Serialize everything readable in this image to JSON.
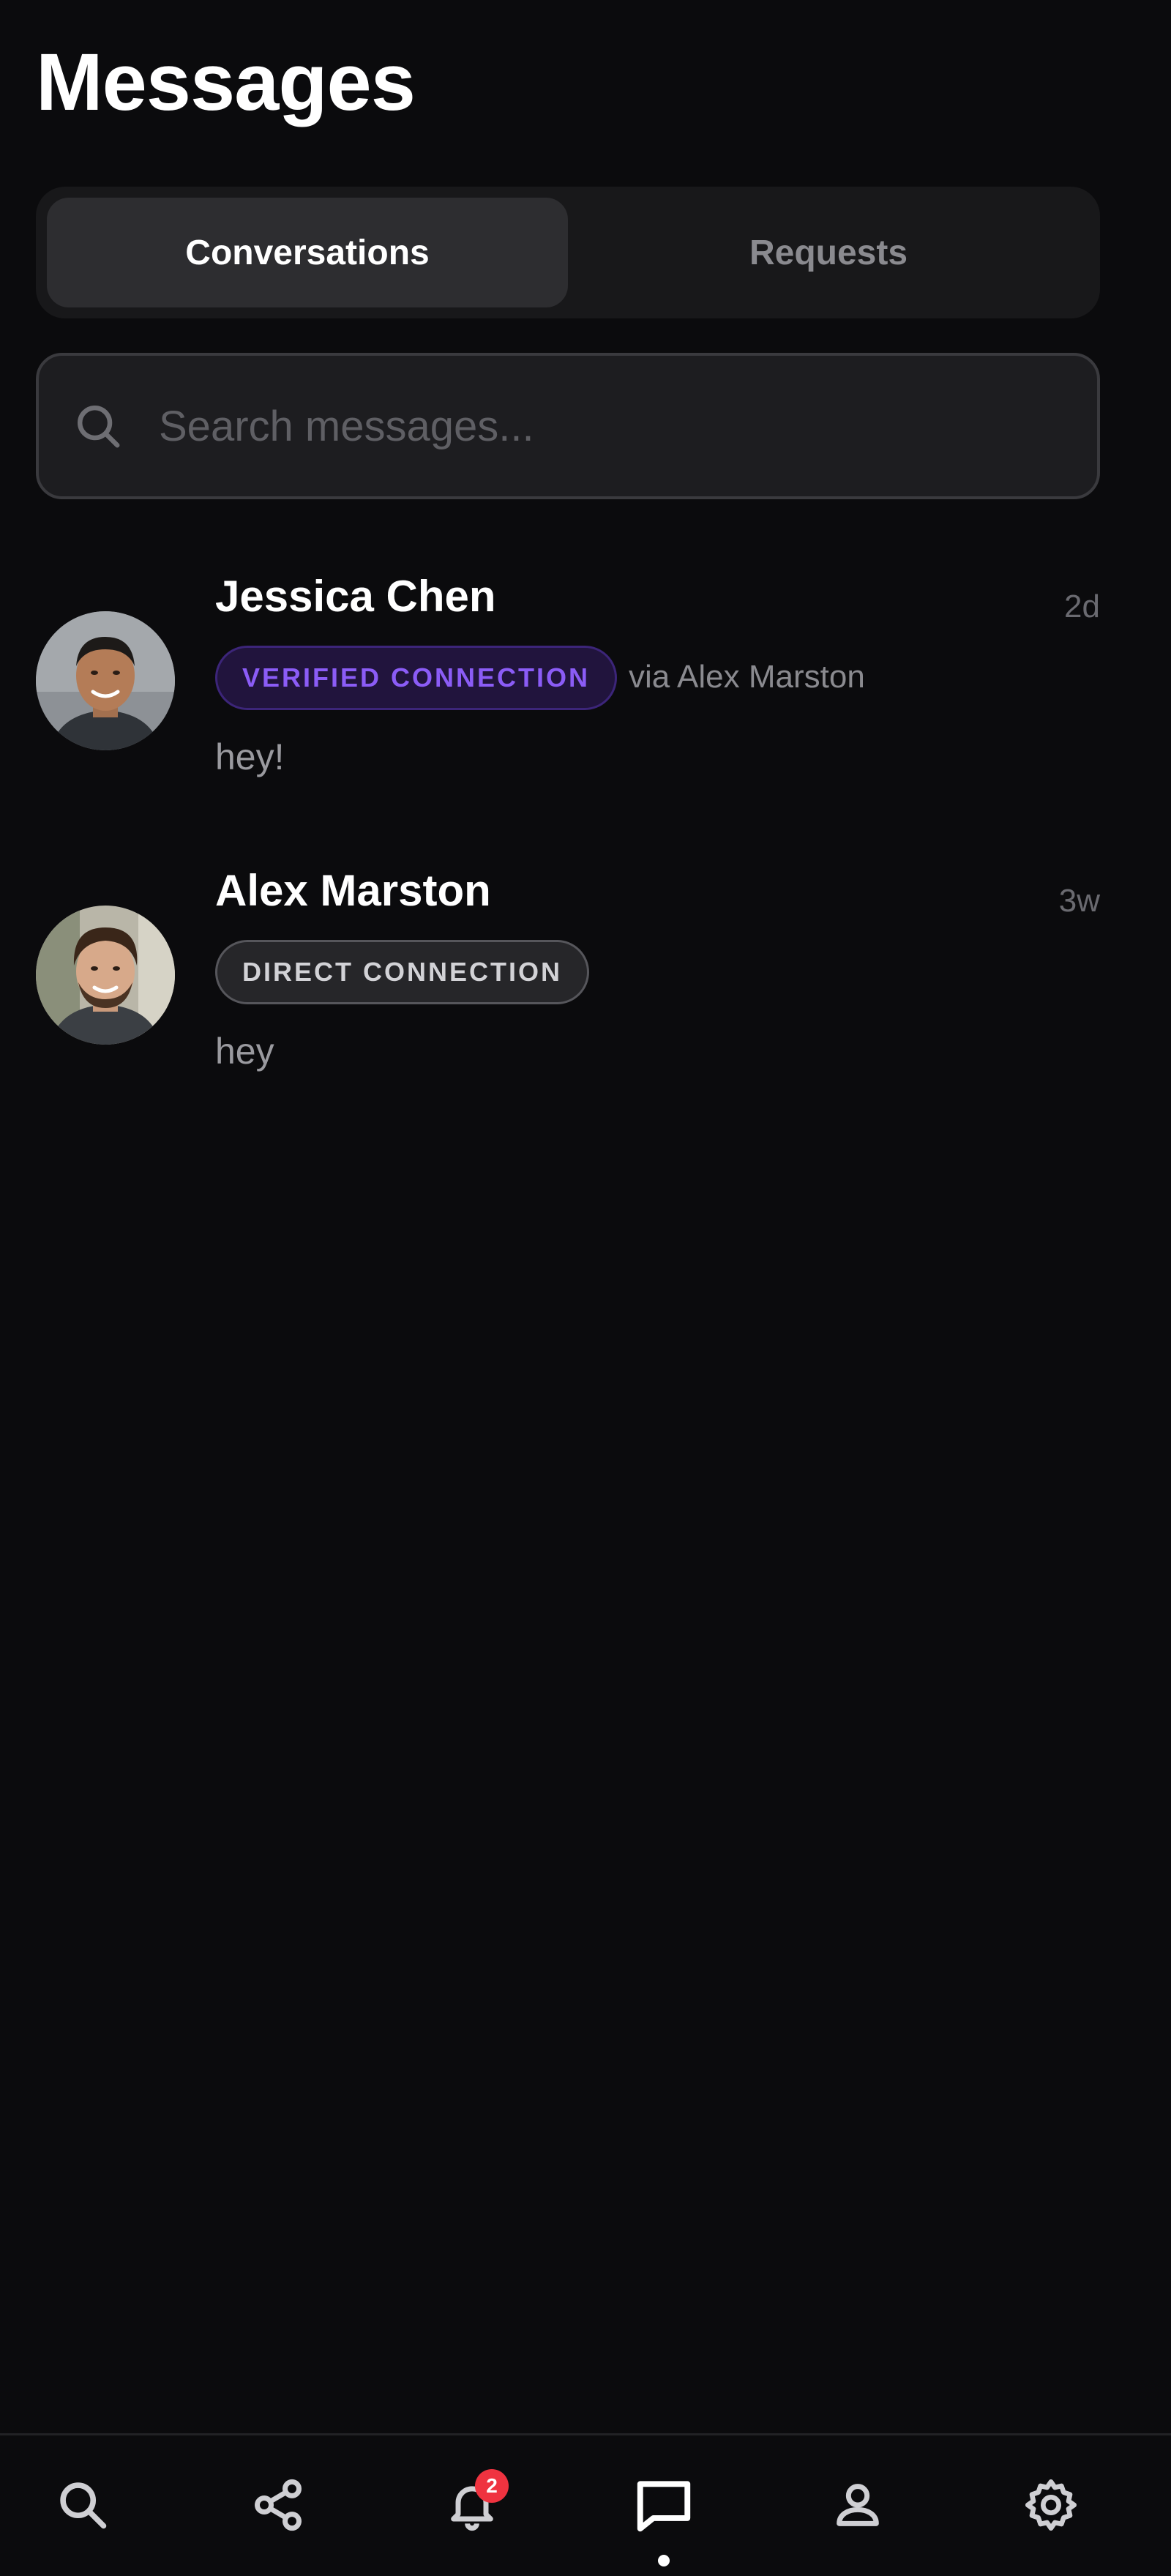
{
  "header": {
    "title": "Messages"
  },
  "tabs": [
    {
      "label": "Conversations",
      "active": true
    },
    {
      "label": "Requests",
      "active": false
    }
  ],
  "search": {
    "placeholder": "Search messages..."
  },
  "conversations": [
    {
      "name": "Jessica Chen",
      "time": "2d",
      "badge": "VERIFIED CONNECTION",
      "badge_type": "verified",
      "via": "via Alex Marston",
      "preview": "hey!"
    },
    {
      "name": "Alex Marston",
      "time": "3w",
      "badge": "DIRECT CONNECTION",
      "badge_type": "direct",
      "via": "",
      "preview": "hey"
    }
  ],
  "bottom_nav": [
    {
      "icon": "search-icon"
    },
    {
      "icon": "share-icon"
    },
    {
      "icon": "bell-icon",
      "badge": "2"
    },
    {
      "icon": "chat-icon",
      "active": true
    },
    {
      "icon": "profile-icon"
    },
    {
      "icon": "gear-icon"
    }
  ],
  "colors": {
    "background": "#0b0b0d",
    "verified_accent": "#8b5cf6",
    "notification_badge": "#ef3340"
  }
}
